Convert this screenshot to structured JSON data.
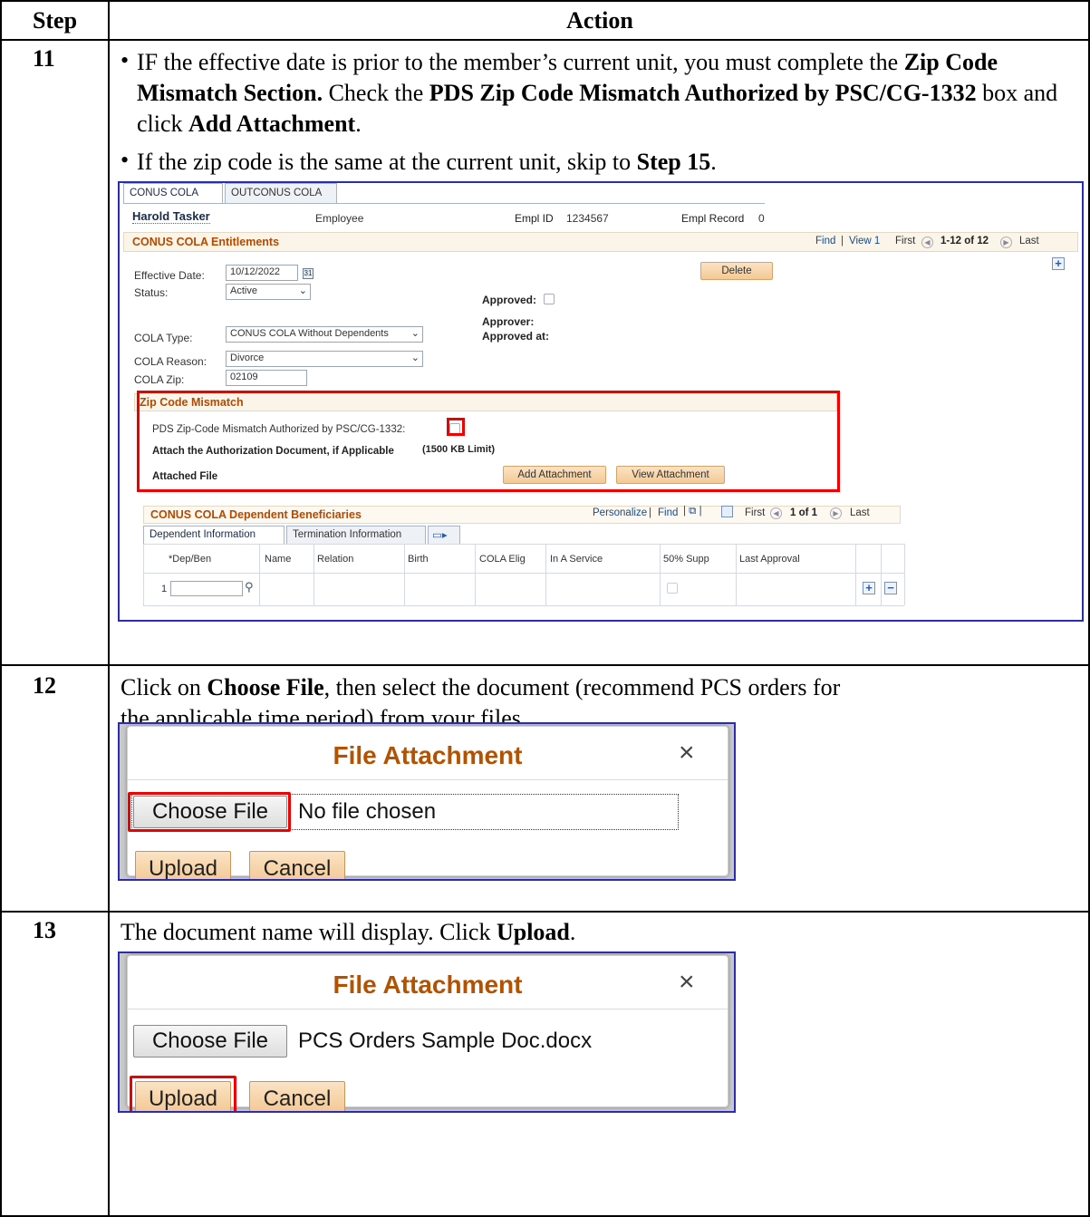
{
  "table": {
    "header_step": "Step",
    "header_action": "Action"
  },
  "step11": {
    "number": "11",
    "bullet1_parts": [
      "IF the effective date is prior to the member’s current unit, you must complete the ",
      "Zip Code Mismatch Section.",
      " Check the ",
      "PDS Zip Code Mismatch Authorized by PSC/CG-1332",
      " box and click ",
      "Add Attachment",
      "."
    ],
    "bullet2_parts": [
      "If the zip code is the same at the current unit, skip to ",
      "Step 15",
      "."
    ],
    "screen": {
      "tabs": [
        "CONUS COLA",
        "OUTCONUS COLA"
      ],
      "employee_name": "Harold Tasker",
      "employee_label": "Employee",
      "empl_id_label": "Empl ID",
      "empl_id": "1234567",
      "empl_record_label": "Empl Record",
      "empl_record": "0",
      "section_title": "CONUS COLA Entitlements",
      "nav_find": "Find",
      "nav_sep": "|",
      "nav_view": "View 1",
      "nav_first": "First",
      "nav_range": "1-12 of 12",
      "nav_last": "Last",
      "effective_date_label": "Effective Date:",
      "effective_date": "10/12/2022",
      "status_label": "Status:",
      "status_value": "Active",
      "delete_button": "Delete",
      "approved_label": "Approved:",
      "approver_label": "Approver:",
      "approved_at_label": "Approved at:",
      "cola_type_label": "COLA Type:",
      "cola_type_value": "CONUS COLA Without Dependents",
      "cola_reason_label": "COLA Reason:",
      "cola_reason_value": "Divorce",
      "cola_zip_label": "COLA Zip:",
      "cola_zip_value": "02109",
      "zip_section_title": "Zip Code Mismatch",
      "pds_label": "PDS Zip-Code Mismatch Authorized by PSC/CG-1332:",
      "attach_label": "Attach the Authorization Document, if Applicable",
      "attach_limit": "(1500 KB Limit)",
      "attached_file_label": "Attached File",
      "add_attachment": "Add Attachment",
      "view_attachment": "View Attachment",
      "dep_title": "CONUS COLA Dependent Beneficiaries",
      "dep_personalize": "Personalize",
      "dep_find": "Find",
      "dep_first": "First",
      "dep_range": "1 of 1",
      "dep_last": "Last",
      "dep_tabs": [
        "Dependent Information",
        "Termination Information"
      ],
      "columns": [
        "*Dep/Ben",
        "Name",
        "Relation",
        "Birth",
        "COLA Elig",
        "In A Service",
        "50% Supp",
        "Last Approval"
      ],
      "row_number": "1"
    }
  },
  "step12": {
    "number": "12",
    "text_parts": [
      "Click on ",
      "Choose File",
      ", then select the document (recommend PCS orders for the applicable time period) from your files."
    ],
    "dialog": {
      "title": "File Attachment",
      "close": "×",
      "choose_file": "Choose File",
      "file_name": "No file chosen",
      "upload": "Upload",
      "cancel": "Cancel"
    }
  },
  "step13": {
    "number": "13",
    "text_parts": [
      "The document name will display. Click ",
      "Upload",
      "."
    ],
    "dialog": {
      "title": "File Attachment",
      "close": "×",
      "choose_file": "Choose File",
      "file_name": "PCS Orders Sample Doc.docx",
      "upload": "Upload",
      "cancel": "Cancel"
    }
  },
  "colors": {
    "highlight_red": "#e00000",
    "frame_blue": "#2b2bb8",
    "title_orange": "#b35200",
    "button_orange": "#f4c994"
  }
}
